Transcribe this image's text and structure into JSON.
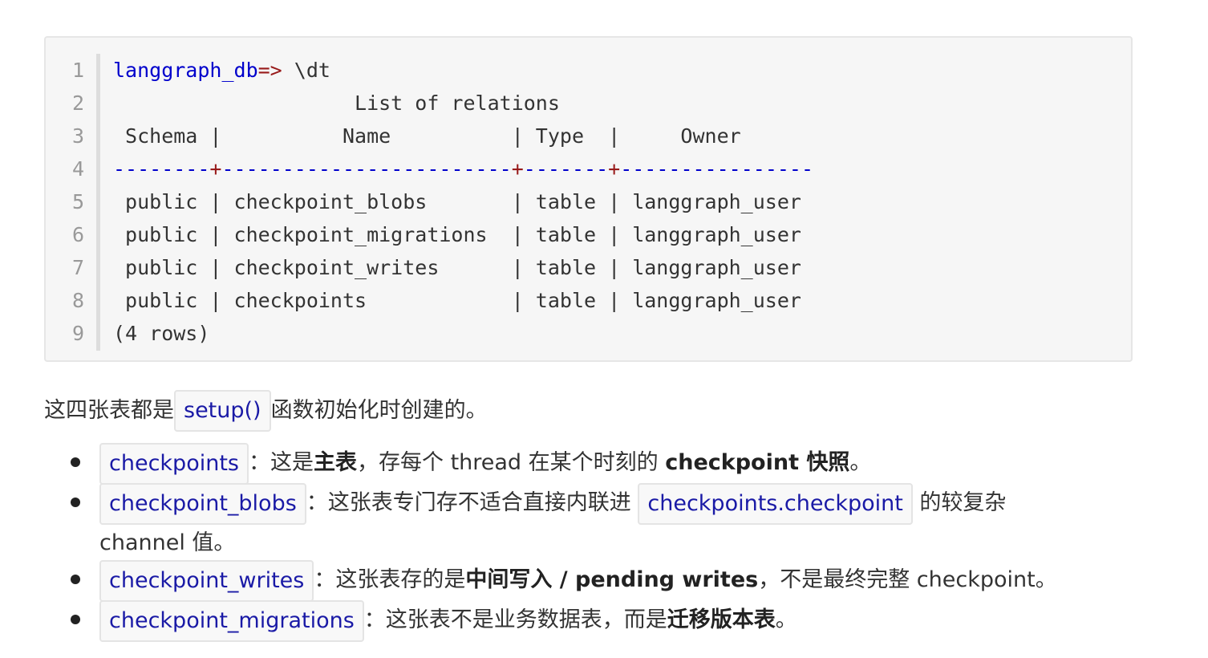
{
  "code": {
    "line_numbers": [
      "1",
      "2",
      "3",
      "4",
      "5",
      "6",
      "7",
      "8",
      "9"
    ],
    "lines": {
      "l1_prompt": "langgraph_db",
      "l1_op": "=>",
      "l1_cmd": " \\dt",
      "l2": "                    List of relations",
      "l3": " Schema |          Name          | Type  |     Owner",
      "l4_a": "--------",
      "l4_b": "+",
      "l4_c": "------------------------",
      "l4_d": "+",
      "l4_e": "-------",
      "l4_f": "+",
      "l4_g": "----------------",
      "l5": " public | checkpoint_blobs       | table | langgraph_user",
      "l6": " public | checkpoint_migrations  | table | langgraph_user",
      "l7": " public | checkpoint_writes      | table | langgraph_user",
      "l8": " public | checkpoints            | table | langgraph_user",
      "l9": "(4 rows)"
    }
  },
  "paragraph": {
    "before": "这四张表都是",
    "code": "setup()",
    "after": "函数初始化时创建的。"
  },
  "bullets": [
    {
      "code": "checkpoints",
      "t1": "：这是",
      "b1": "主表",
      "t2": "，存每个 thread 在某个时刻的 ",
      "b2": "checkpoint 快照",
      "t3": "。"
    },
    {
      "code": "checkpoint_blobs",
      "t1": "：这张表专门存不适合直接内联进 ",
      "code2": "checkpoints.checkpoint",
      "t2": " 的较复杂 channel 值。"
    },
    {
      "code": "checkpoint_writes",
      "t1": "：这张表存的是",
      "b1": "中间写入 / pending writes",
      "t2": "，不是最终完整 checkpoint。"
    },
    {
      "code": "checkpoint_migrations",
      "t1": "：这张表不是业务数据表，而是",
      "b1": "迁移版本表",
      "t2": "。"
    }
  ]
}
